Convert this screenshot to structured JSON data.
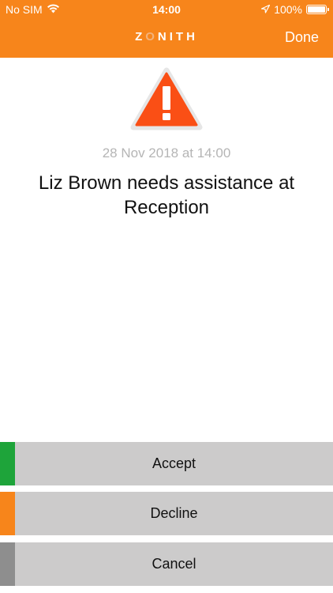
{
  "status_bar": {
    "carrier": "No SIM",
    "time": "14:00",
    "battery": "100%",
    "battery_level": 1.0,
    "icons": [
      "wifi-icon",
      "location-arrow-icon",
      "battery-icon"
    ]
  },
  "header": {
    "logo_text": "ZONITH",
    "done_label": "Done",
    "color": "#f7851b"
  },
  "alert": {
    "icon": "warning-triangle-icon",
    "icon_color": "#fa4f15",
    "timestamp": "28 Nov 2018 at 14:00",
    "message": "Liz Brown needs assistance at Reception"
  },
  "actions": [
    {
      "label": "Accept",
      "color": "#1ea43a"
    },
    {
      "label": "Decline",
      "color": "#f7851b"
    },
    {
      "label": "Cancel",
      "color": "#8e8e8e"
    }
  ]
}
